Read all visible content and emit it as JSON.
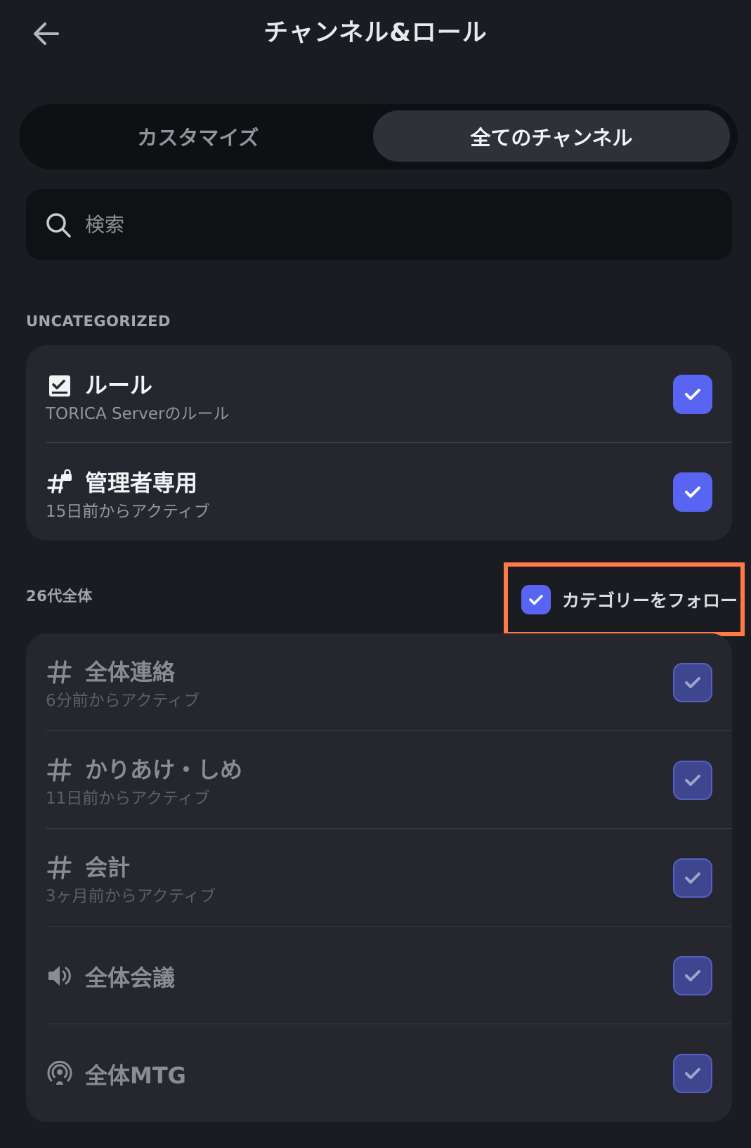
{
  "header": {
    "title": "チャンネル&ロール"
  },
  "tabs": [
    {
      "label": "カスタマイズ",
      "selected": false
    },
    {
      "label": "全てのチャンネル",
      "selected": true
    }
  ],
  "search": {
    "placeholder": "検索",
    "value": ""
  },
  "sections": [
    {
      "label": "UNCATEGORIZED",
      "items": [
        {
          "name": "ルール",
          "subtitle": "TORICA Serverのルール",
          "icon": "rules-icon",
          "checked": true
        },
        {
          "name": "管理者専用",
          "subtitle": "15日前からアクティブ",
          "icon": "locked-hashtag-icon",
          "checked": true
        }
      ]
    },
    {
      "label": "26代全体",
      "follow_label": "カテゴリーをフォロー",
      "follow_checked": true,
      "items": [
        {
          "name": "全体連絡",
          "subtitle": "6分前からアクティブ",
          "icon": "hashtag-icon",
          "checked": true
        },
        {
          "name": "かりあけ・しめ",
          "subtitle": "11日前からアクティブ",
          "icon": "hashtag-icon",
          "checked": true
        },
        {
          "name": "会計",
          "subtitle": "3ヶ月前からアクティブ",
          "icon": "hashtag-icon",
          "checked": true
        },
        {
          "name": "全体会議",
          "subtitle": "",
          "icon": "speaker-icon",
          "checked": true
        },
        {
          "name": "全体MTG",
          "subtitle": "",
          "icon": "stage-icon",
          "checked": true
        }
      ]
    }
  ],
  "colors": {
    "accent": "#5865f2",
    "highlight": "#ff7a45",
    "background": "#1b1c21",
    "card": "#26272e"
  }
}
